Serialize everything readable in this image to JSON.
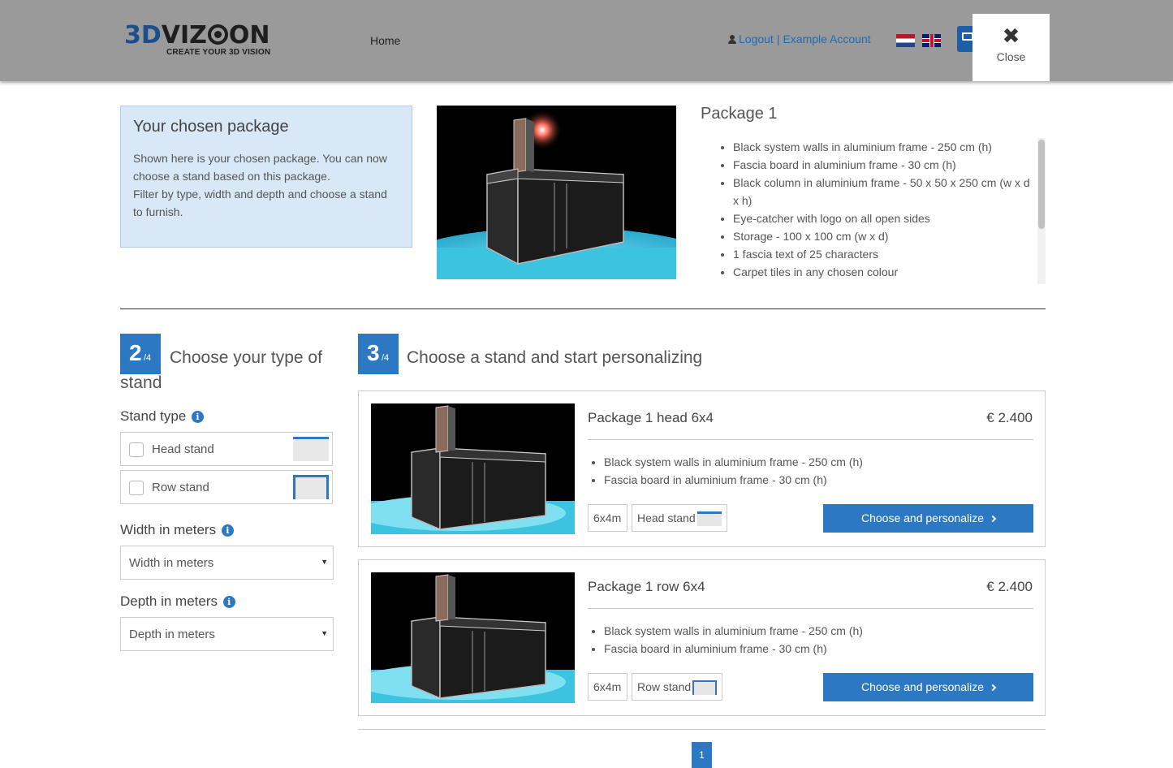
{
  "header": {
    "logo_prefix": "3D",
    "logo_text_a": "VIZ",
    "logo_text_b": "ON",
    "logo_tagline": "CREATE YOUR 3D VISION",
    "nav_home": "Home",
    "logout": "Logout",
    "separator": "|",
    "account": "Example Account",
    "close_label": "Close",
    "close_icon": "✖"
  },
  "chosen": {
    "title": "Your chosen package",
    "line1": "Shown here is your chosen package. You can now choose a stand based on this package.",
    "line2": "Filter by type, width and depth and choose a stand to furnish."
  },
  "package": {
    "title": "Package 1",
    "features": [
      "Black system walls in aluminium frame - 250 cm (h)",
      "Fascia board in aluminium frame - 30 cm (h)",
      "Black column in aluminium frame - 50 x 50 x 250 cm (w x d x h)",
      "Eye-catcher with logo on all open sides",
      "Storage - 100 x 100 cm (w x d)",
      "1 fascia text of 25 characters",
      "Carpet tiles in any chosen colour"
    ]
  },
  "step2": {
    "num": "2",
    "of": "/4",
    "title": "Choose your type of stand"
  },
  "step3": {
    "num": "3",
    "of": "/4",
    "title": "Choose a stand and start personalizing"
  },
  "filters": {
    "stand_type_label": "Stand type",
    "head_stand": "Head stand",
    "row_stand": "Row stand",
    "width_label": "Width in meters",
    "width_placeholder": "Width in meters",
    "depth_label": "Depth in meters",
    "depth_placeholder": "Depth in meters",
    "info_glyph": "i",
    "arrow_glyph": "▼"
  },
  "results": [
    {
      "name": "Package 1 head 6x4",
      "price": "€ 2.400",
      "features": [
        "Black system walls in aluminium frame - 250 cm (h)",
        "Fascia board in aluminium frame - 30 cm (h)"
      ],
      "size": "6x4m",
      "type": "Head stand",
      "button": "Choose and personalize"
    },
    {
      "name": "Package 1 row 6x4",
      "price": "€ 2.400",
      "features": [
        "Black system walls in aluminium frame - 250 cm (h)",
        "Fascia board in aluminium frame - 30 cm (h)"
      ],
      "size": "6x4m",
      "type": "Row stand",
      "button": "Choose and personalize"
    }
  ],
  "pagination": {
    "current": "1"
  },
  "colors": {
    "accent": "#2c78c2",
    "header_bg": "#9a9a9a",
    "info_bg": "#d9e8f6"
  }
}
